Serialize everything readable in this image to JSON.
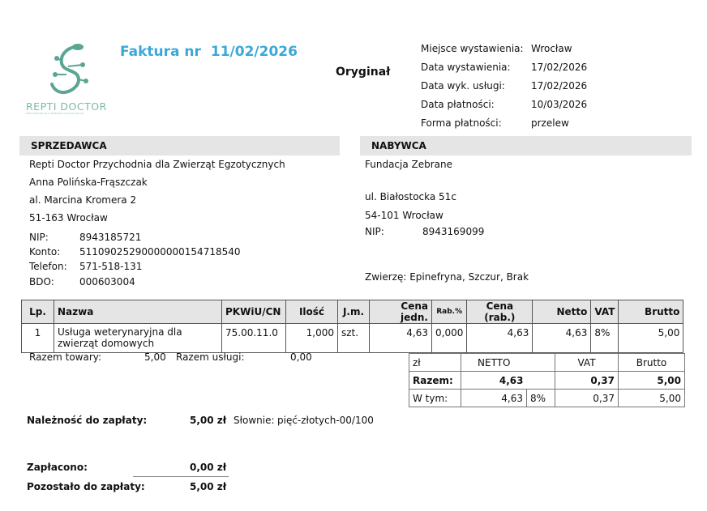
{
  "logo": {
    "name": "REPTI DOCTOR",
    "tagline": "PRZYCHODNIA DLA ZWIERZĄT EGZOTYCZNYCH"
  },
  "header": {
    "title_label": "Faktura nr",
    "invoice_number": "11/02/2026",
    "copy_label": "Oryginał"
  },
  "meta": [
    {
      "label": "Miejsce wystawienia:",
      "value": "Wrocław"
    },
    {
      "label": "Data wystawienia:",
      "value": "17/02/2026"
    },
    {
      "label": "Data wyk. usługi:",
      "value": "17/02/2026"
    },
    {
      "label": "Data płatności:",
      "value": "10/03/2026"
    },
    {
      "label": "Forma płatności:",
      "value": "przelew"
    }
  ],
  "seller": {
    "heading": "SPRZEDAWCA",
    "name": "Repti Doctor Przychodnia dla Zwierząt Egzotycznych",
    "person": "Anna Polińska-Frąszczak",
    "street": "al. Marcina Kromera 2",
    "city": "51-163 Wrocław",
    "fields": [
      {
        "label": "NIP:",
        "value": "8943185721"
      },
      {
        "label": "Konto:",
        "value": "51109025290000000154718540"
      },
      {
        "label": "Telefon:",
        "value": "571-518-131"
      },
      {
        "label": "BDO:",
        "value": "000603004"
      }
    ]
  },
  "buyer": {
    "heading": "NABYWCA",
    "name": "Fundacja Zebrane",
    "street": "ul. Białostocka 51c",
    "city": "54-101 Wrocław",
    "nip_label": "NIP:",
    "nip": "8943169099",
    "animals": "Zwierzę: Epinefryna, Szczur, Brak"
  },
  "items_table": {
    "headers": [
      "Lp.",
      "Nazwa",
      "PKWiU/CN",
      "Ilość",
      "J.m.",
      "Cena jedn.",
      "Rab.%",
      "Cena (rab.)",
      "Netto",
      "VAT",
      "Brutto"
    ],
    "rows": [
      [
        "1",
        "Usługa weterynaryjna dla zwierząt domowych",
        "75.00.11.0",
        "1,000",
        "szt.",
        "4,63",
        "0,000",
        "4,63",
        "4,63",
        "8%",
        "5,00"
      ]
    ]
  },
  "razem": {
    "towary_label": "Razem towary:",
    "towary_value": "5,00",
    "uslugi_label": "Razem usługi:",
    "uslugi_value": "0,00"
  },
  "summary": {
    "currency": "zł",
    "netto_label": "NETTO",
    "vat_label": "VAT",
    "brutto_label": "Brutto",
    "total_label": "Razem:",
    "total_netto": "4,63",
    "total_vat": "0,37",
    "total_brutto": "5,00",
    "wtym_label": "W tym:",
    "wtym_netto": "4,63",
    "wtym_rate": "8%",
    "wtym_vat": "0,37",
    "wtym_brutto": "5,00"
  },
  "totals": {
    "due_label": "Należność do zapłaty:",
    "due_value": "5,00 zł",
    "words_label": "Słownie:",
    "words": "pięć-złotych-00/100",
    "paid_label": "Zapłacono:",
    "paid_value": "0,00 zł",
    "remaining_label": "Pozostało do zapłaty:",
    "remaining_value": "5,00 zł"
  },
  "colors": {
    "title": "#3aa8d8",
    "logo": "#5aa593",
    "bar": "#e5e5e5"
  }
}
